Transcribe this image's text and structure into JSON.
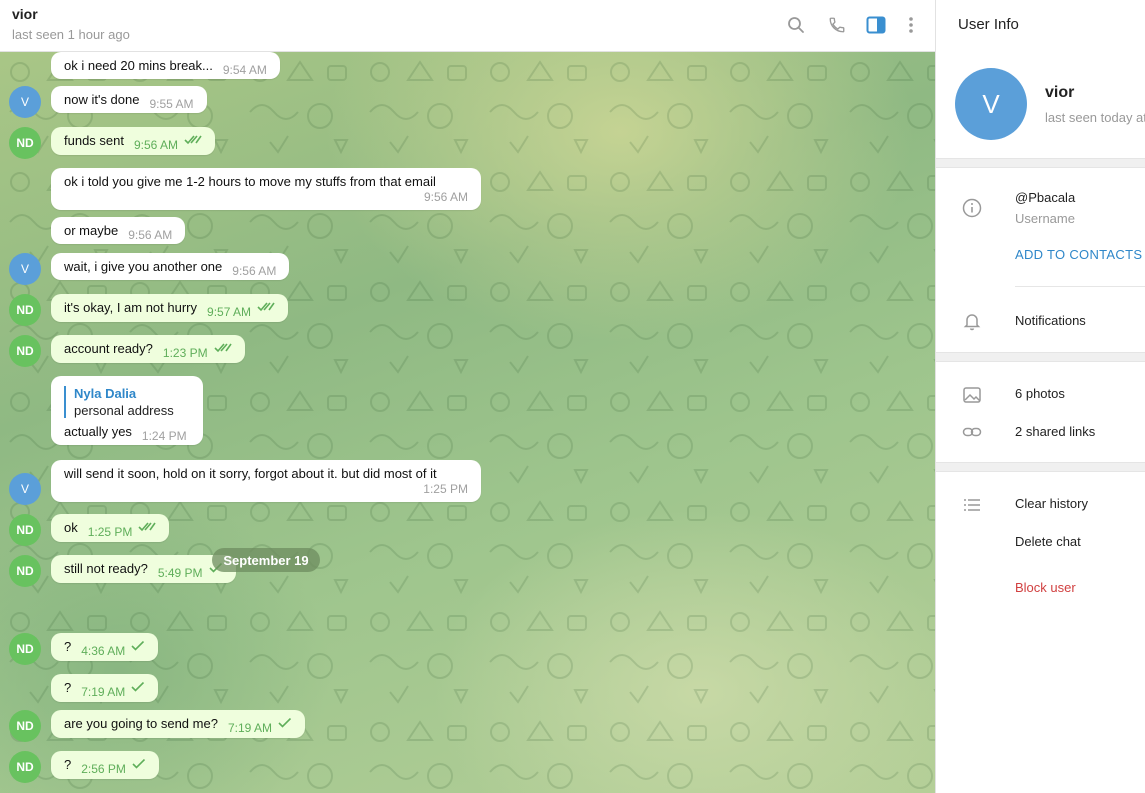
{
  "header": {
    "peer_name": "vior",
    "peer_status": "last seen 1 hour ago",
    "icons": [
      "search-icon",
      "phone-icon",
      "sidebar-toggle-icon",
      "more-vertical-icon"
    ],
    "accent_color": "#3a8fd0"
  },
  "messages": [
    {
      "avatar": "",
      "text": "ok i need 20 mins break...",
      "time": "9:54 AM",
      "out": false
    },
    {
      "avatar": "V",
      "text": "now it's done",
      "time": "9:55 AM",
      "out": false
    },
    {
      "avatar": "ND",
      "text": "funds sent",
      "time": "9:56 AM",
      "out": true,
      "ticks": "double"
    },
    {
      "avatar": "",
      "text": "ok i told you give me 1-2 hours to move my stuffs from that email",
      "time": "9:56 AM",
      "out": false
    },
    {
      "avatar": "",
      "text": "or maybe",
      "time": "9:56 AM",
      "out": false
    },
    {
      "avatar": "V",
      "text": "wait, i give you another one",
      "time": "9:56 AM",
      "out": false
    },
    {
      "avatar": "ND",
      "text": "it's okay, I am not hurry",
      "time": "9:57 AM",
      "out": true,
      "ticks": "double"
    },
    {
      "avatar": "ND",
      "text": "account ready?",
      "time": "1:23 PM",
      "out": true,
      "ticks": "double"
    },
    {
      "avatar": "",
      "reply_name": "Nyla Dalia",
      "reply_text": "personal address",
      "text": "actually yes",
      "time": "1:24 PM",
      "out": false
    },
    {
      "avatar": "V",
      "text": "will send it soon, hold on it sorry, forgot about it. but did most of it",
      "time": "1:25 PM",
      "out": false
    },
    {
      "avatar": "ND",
      "text": "ok",
      "time": "1:25 PM",
      "out": true,
      "ticks": "double"
    },
    {
      "avatar": "ND",
      "text": "still not ready?",
      "time": "5:49 PM",
      "out": true,
      "ticks": "single"
    },
    {
      "date": "September 19"
    },
    {
      "avatar": "ND",
      "text": "?",
      "time": "4:36 AM",
      "out": true,
      "ticks": "single"
    },
    {
      "avatar": "",
      "text": "?",
      "time": "7:19 AM",
      "out": true,
      "ticks": "single"
    },
    {
      "avatar": "ND",
      "text": "are you going to send me?",
      "time": "7:19 AM",
      "out": true,
      "ticks": "single"
    },
    {
      "avatar": "ND",
      "text": "?",
      "time": "2:56 PM",
      "out": true,
      "ticks": "single"
    }
  ],
  "panel": {
    "title": "User Info",
    "avatar_letter": "V",
    "name": "vior",
    "status": "last seen today at",
    "username": "@Pbacala",
    "username_label": "Username",
    "add_contacts": "ADD TO CONTACTS",
    "notifications": "Notifications",
    "photos": "6 photos",
    "links": "2 shared links",
    "clear_history": "Clear history",
    "delete_chat": "Delete chat",
    "block_user": "Block user",
    "danger_color": "#d14040"
  }
}
